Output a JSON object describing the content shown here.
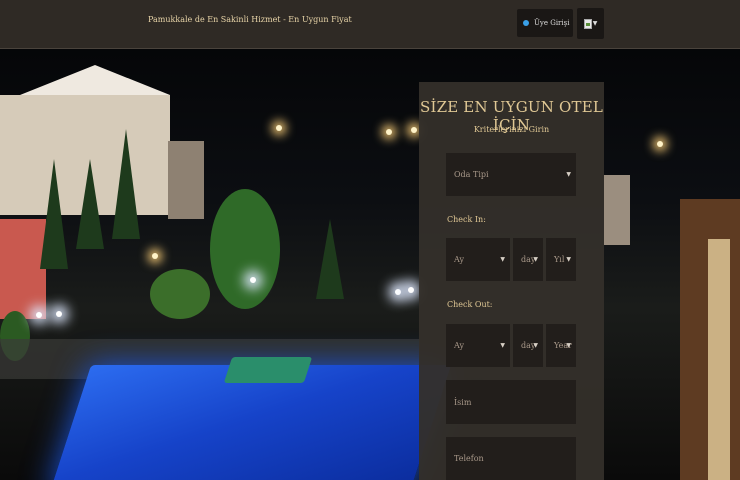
{
  "header": {
    "site_title": "Pamukkale de En Sakinli Hizmet - En Uygun Fiyat",
    "login_label": "Üye Girişi",
    "login_icon": "user-icon",
    "lang_icon": "flag-icon"
  },
  "form": {
    "title": "SİZE EN UYGUN OTEL İÇİN",
    "subtitle": "Kriterlerinizi Girin",
    "room_type_placeholder": "Oda Tipi",
    "checkin_label": "Check In:",
    "checkin_month": "Ay",
    "checkin_day": "day",
    "checkin_year": "Yıl",
    "checkout_label": "Check Out:",
    "checkout_month": "Ay",
    "checkout_day": "day",
    "checkout_year": "Year",
    "name_placeholder": "İsim",
    "phone_placeholder": "Telefon"
  },
  "colors": {
    "header_bg": "#2f2a25",
    "panel_bg": "#342f2a",
    "accent_gold": "#e0c895",
    "field_bg": "#221e1b"
  }
}
